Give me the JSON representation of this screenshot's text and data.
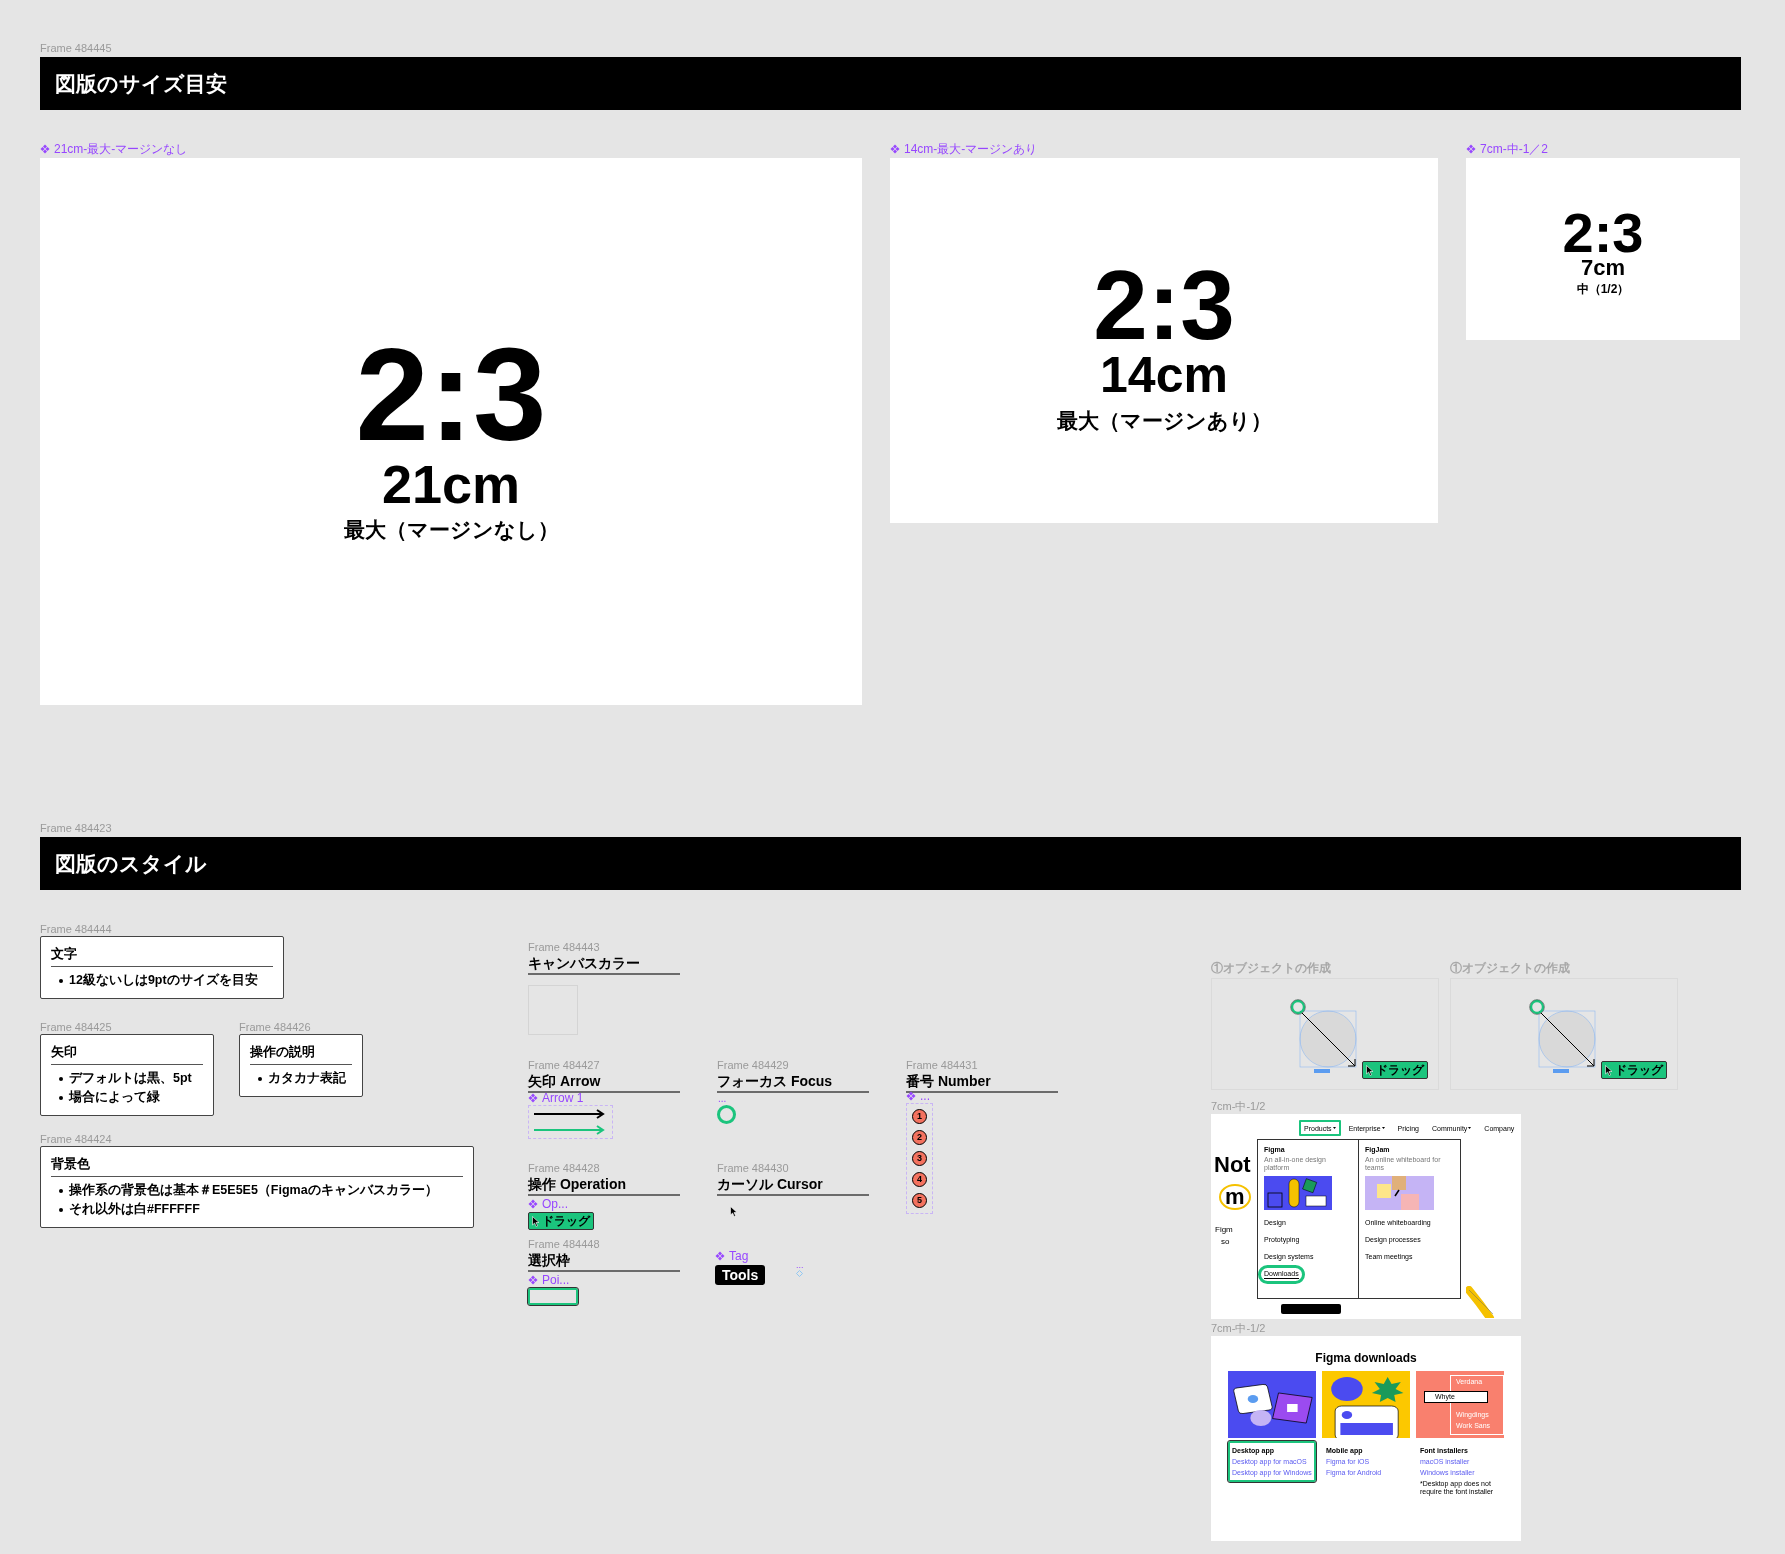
{
  "size_section": {
    "frame_label": "Frame 484445",
    "title": "図版のサイズ目安",
    "cards": [
      {
        "component_label": "21cm-最大-マージンなし",
        "ratio": "2:3",
        "size": "21cm",
        "caption": "最大（マージンなし）"
      },
      {
        "component_label": "14cm-最大-マージンあり",
        "ratio": "2:3",
        "size": "14cm",
        "caption": "最大（マージンあり）"
      },
      {
        "component_label": "7cm-中-1／2",
        "ratio": "2:3",
        "size": "7cm",
        "caption": "中（1/2）"
      }
    ]
  },
  "style_section": {
    "frame_label": "Frame 484423",
    "title": "図版のスタイル",
    "notes": [
      {
        "frame_label": "Frame 484444",
        "heading": "文字",
        "bullets": [
          "12級ないしは9ptのサイズを目安"
        ]
      },
      {
        "frame_label": "Frame 484425",
        "heading": "矢印",
        "bullets": [
          "デフォルトは黒、5pt",
          "場合によって緑"
        ]
      },
      {
        "frame_label": "Frame 484426",
        "heading": "操作の説明",
        "bullets": [
          "カタカナ表記"
        ]
      },
      {
        "frame_label": "Frame 484424",
        "heading": "背景色",
        "bullets": [
          "操作系の背景色は基本＃E5E5E5（Figmaのキャンバスカラー）",
          "それ以外は白#FFFFFF"
        ]
      }
    ],
    "canvas_color": {
      "frame_label": "Frame 484443",
      "heading": "キャンバスカラー"
    },
    "arrow": {
      "frame_label": "Frame 484427",
      "heading": "矢印 Arrow",
      "component_label": "Arrow 1",
      "arrows": [
        {
          "color": "#000000"
        },
        {
          "color": "#1bc47d"
        }
      ]
    },
    "focus": {
      "frame_label": "Frame 484429",
      "heading": "フォーカス Focus",
      "component_label": "..."
    },
    "number": {
      "frame_label": "Frame 484431",
      "heading": "番号 Number",
      "component_label": "...",
      "badges": [
        "1",
        "2",
        "3",
        "4",
        "5"
      ]
    },
    "operation": {
      "frame_label": "Frame 484428",
      "heading": "操作 Operation",
      "component_label": "Op...",
      "tag": "ドラッグ"
    },
    "cursor": {
      "frame_label": "Frame 484430",
      "heading": "カーソル Cursor"
    },
    "selection": {
      "frame_label": "Frame 484448",
      "heading": "選択枠",
      "component_label": "Poi..."
    },
    "tag": {
      "component_label": "Tag",
      "text": "Tools"
    },
    "stray_component": {
      "label": "..."
    },
    "examples": [
      {
        "title": "①オブジェクトの作成",
        "tag": "ドラッグ"
      },
      {
        "title": "①オブジェクトの作成",
        "tag": "ドラッグ"
      }
    ],
    "screenshots": [
      {
        "kind": "menu",
        "component_label": "7cm-中-1/2",
        "nav": [
          {
            "label": "Products",
            "dropdown": true,
            "selected": true
          },
          {
            "label": "Enterprise",
            "dropdown": true,
            "selected": false
          },
          {
            "label": "Pricing",
            "dropdown": false,
            "selected": false
          },
          {
            "label": "Community",
            "dropdown": true,
            "selected": false
          },
          {
            "label": "Company",
            "dropdown": false,
            "selected": false
          }
        ],
        "hero_lines": [
          "Not",
          "m"
        ],
        "hero_subtext": [
          "Figm",
          "so"
        ],
        "menu_columns": [
          {
            "title": "Figma",
            "subtitle": "An all-in-one design platform",
            "items": [
              {
                "label": "Design",
                "selected": false
              },
              {
                "label": "Prototyping",
                "selected": false
              },
              {
                "label": "Design systems",
                "selected": false
              },
              {
                "label": "Downloads",
                "selected": true
              }
            ]
          },
          {
            "title": "FigJam",
            "subtitle": "An online whiteboard for teams",
            "items": [
              {
                "label": "Online whiteboarding",
                "selected": false
              },
              {
                "label": "Design processes",
                "selected": false
              },
              {
                "label": "Team meetings",
                "selected": false
              }
            ]
          }
        ]
      },
      {
        "kind": "downloads",
        "component_label": "7cm-中-1/2",
        "title": "Figma downloads",
        "font_samples": [
          "Verdana",
          "Whyte",
          "Wingdings",
          "Work Sans"
        ],
        "columns": [
          {
            "heading": "Desktop app",
            "links": [
              "Desktop app for macOS",
              "Desktop app for Windows"
            ],
            "selected": true
          },
          {
            "heading": "Mobile app",
            "links": [
              "Figma for iOS",
              "Figma for Android"
            ],
            "selected": false
          },
          {
            "heading": "Font installers",
            "links": [
              "macOS installer",
              "Windows installer"
            ],
            "note": "*Desktop app does not require the font installer",
            "selected": false
          }
        ]
      }
    ]
  }
}
